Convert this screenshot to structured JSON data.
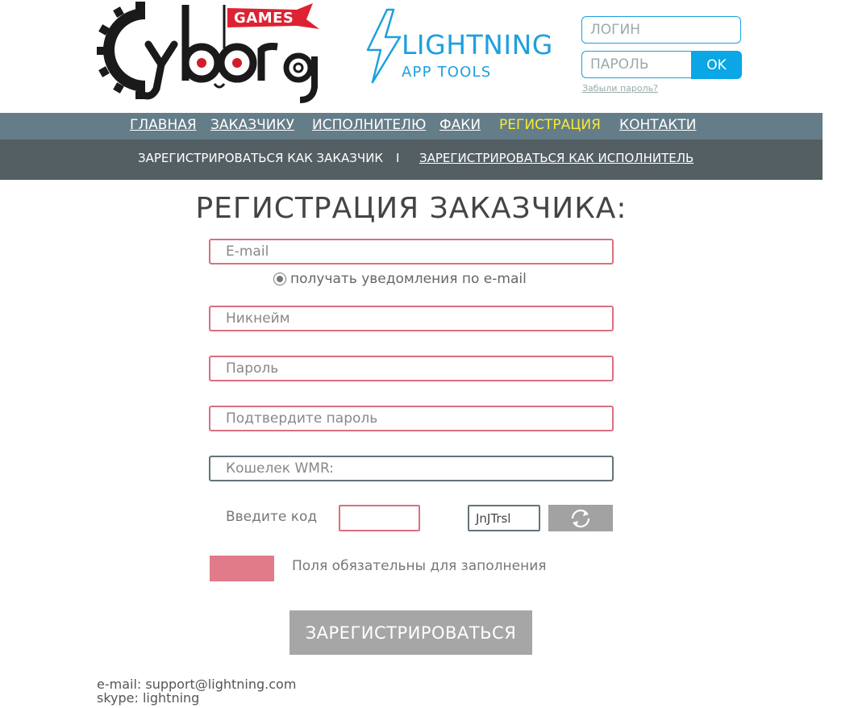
{
  "logos": {
    "cyborg_badge": "GAMES",
    "cyborg_word": "Cyborg",
    "lightning_title": "LIGHTNING",
    "lightning_sub": "APP TOOLS"
  },
  "login": {
    "login_placeholder": "ЛОГИН",
    "password_placeholder": "ПАРОЛЬ",
    "ok_label": "OK",
    "forgot_label": "Забыли пароль?"
  },
  "nav": {
    "items": [
      {
        "label": "ГЛАВНАЯ"
      },
      {
        "label": "ЗАКАЗЧИКУ"
      },
      {
        "label": "ИСПОЛНИТЕЛЮ"
      },
      {
        "label": "ФАКИ"
      },
      {
        "label": "РЕГИСТРАЦИЯ"
      },
      {
        "label": "КОНТАКТИ"
      }
    ],
    "active_color": "#f6ea38",
    "bar_color": "#647d88"
  },
  "subnav": {
    "customer": "ЗАРЕГИСТРИРОВАТЬСЯ  КАК ЗАКАЗЧИК",
    "separator": "I",
    "performer": "ЗАРЕГИСТРИРОВАТЬСЯ  КАК ИСПОЛНИТЕЛЬ",
    "bar_color": "#545f63"
  },
  "form": {
    "title": "РЕГИСТРАЦИЯ ЗАКАЗЧИКА:",
    "email_placeholder": "E-mail",
    "notify_label": "получать уведомления по e-mail",
    "nickname_placeholder": "Никнейм",
    "password_placeholder": "Пароль",
    "confirm_placeholder": "Подтвердите пароль",
    "wallet_placeholder": "Кошелек WMR:",
    "code_label": "Введите код",
    "captcha_text": "JnJTrsl",
    "required_note": "Поля обязательны для заполнения",
    "required_color": "#e27b89",
    "submit_label": "ЗАРЕГИСТРИРОВАТЬСЯ"
  },
  "footer": {
    "email": "e-mail: support@lightning.com",
    "skype": "skype: lightning"
  },
  "icons": [
    "gear-icon",
    "lightning-bolt-icon",
    "radio-icon",
    "refresh-icon"
  ]
}
